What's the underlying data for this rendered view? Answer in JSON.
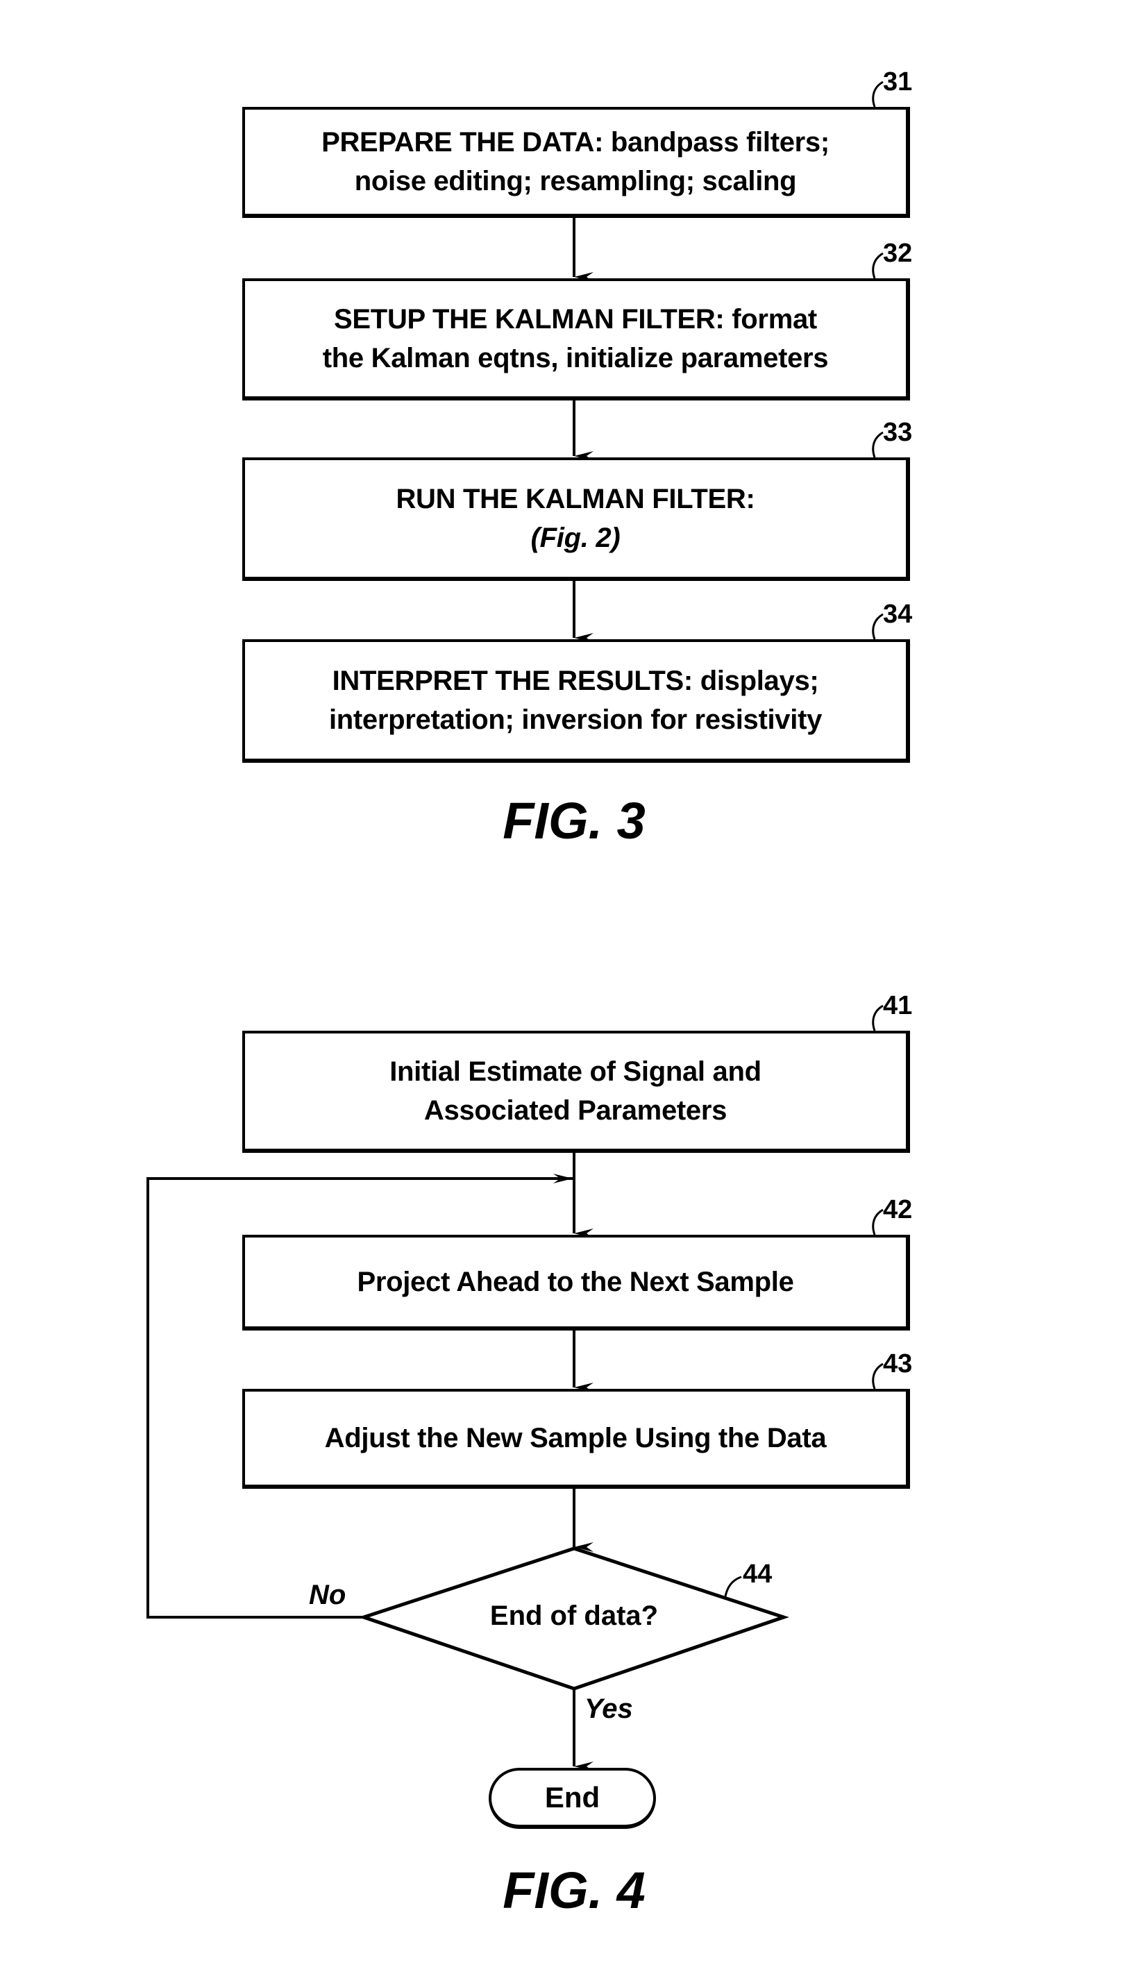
{
  "fig3": {
    "caption": "FIG. 3",
    "steps": [
      {
        "ref": "31",
        "lines": [
          "PREPARE THE DATA:  bandpass filters;",
          "noise editing; resampling; scaling"
        ]
      },
      {
        "ref": "32",
        "lines": [
          "SETUP THE KALMAN FILTER: format",
          "the Kalman eqtns, initialize parameters"
        ]
      },
      {
        "ref": "33",
        "lines": [
          "RUN THE KALMAN FILTER:",
          "(Fig. 2)"
        ]
      },
      {
        "ref": "34",
        "lines": [
          "INTERPRET THE RESULTS:  displays;",
          "interpretation; inversion for resistivity"
        ]
      }
    ]
  },
  "fig4": {
    "caption": "FIG. 4",
    "steps": [
      {
        "ref": "41",
        "lines": [
          "Initial Estimate of Signal and",
          "Associated Parameters"
        ]
      },
      {
        "ref": "42",
        "lines": [
          "Project Ahead to the Next Sample"
        ]
      },
      {
        "ref": "43",
        "lines": [
          "Adjust the New Sample Using the Data"
        ]
      }
    ],
    "decision": {
      "ref": "44",
      "text": "End of data?",
      "no_label": "No",
      "yes_label": "Yes"
    },
    "terminal": {
      "text": "End"
    }
  }
}
